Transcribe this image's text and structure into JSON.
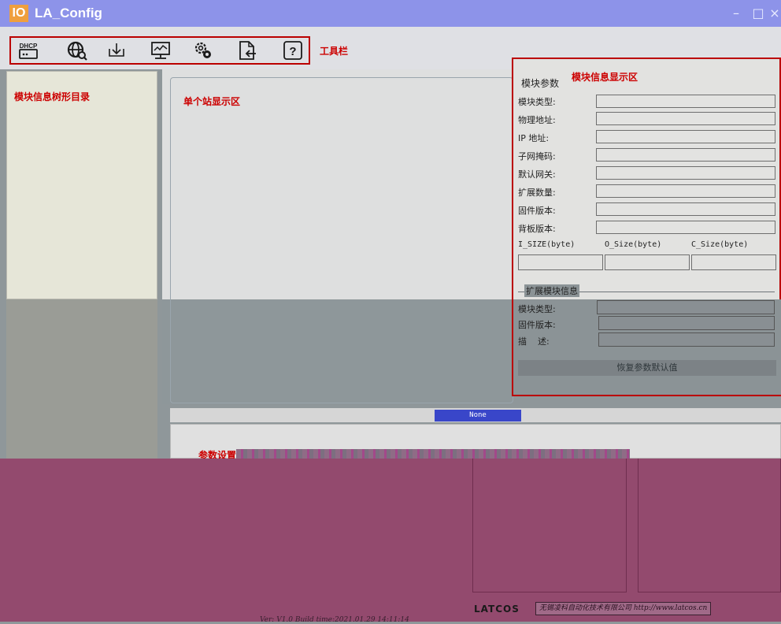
{
  "window": {
    "badge": "IO",
    "title": "LA_Config",
    "controls": {
      "minimize": "–",
      "maximize": "□",
      "close": "×"
    }
  },
  "toolbar": {
    "label": "工具栏",
    "buttons": [
      {
        "name": "dhcp",
        "icon": "dhcp-icon",
        "text": "DHCP"
      },
      {
        "name": "network-scan",
        "icon": "globe-search-icon"
      },
      {
        "name": "download",
        "icon": "download-icon"
      },
      {
        "name": "monitor",
        "icon": "monitor-chart-icon"
      },
      {
        "name": "settings",
        "icon": "gears-icon"
      },
      {
        "name": "export",
        "icon": "file-export-icon"
      },
      {
        "name": "help",
        "icon": "help-icon",
        "text": "?"
      }
    ]
  },
  "tree": {
    "label": "模块信息树形目录"
  },
  "station": {
    "label": "单个站显示区"
  },
  "info": {
    "title": "模块信息显示区",
    "group_title": "模块参数",
    "fields": [
      {
        "label": "模块类型:",
        "value": ""
      },
      {
        "label": "物理地址:",
        "value": ""
      },
      {
        "label": " IP 地址:",
        "value": ""
      },
      {
        "label": "子网掩码:",
        "value": ""
      },
      {
        "label": "默认网关:",
        "value": ""
      },
      {
        "label": "扩展数量:",
        "value": ""
      },
      {
        "label": "固件版本:",
        "value": ""
      },
      {
        "label": "背板版本:",
        "value": ""
      }
    ],
    "size_headers": [
      "I_SIZE(byte)",
      "O_Size(byte)",
      "C_Size(byte)"
    ],
    "size_values": [
      "",
      "",
      ""
    ],
    "ext": {
      "title": "扩展模块信息",
      "fields": [
        {
          "label": "模块类型:",
          "value": ""
        },
        {
          "label": "固件版本:",
          "value": ""
        },
        {
          "label": "描    述:",
          "value": ""
        }
      ]
    },
    "restore_button": "恢复参数默认值"
  },
  "status": {
    "badge": "None"
  },
  "params": {
    "label": "参数设置"
  },
  "footer": {
    "version": "Ver: V1.0 Build time:2021.01.29 14:11:14",
    "logo": "LATCOS",
    "company": "无锡凌科自动化技术有限公司 http://www.latcos.cn"
  },
  "colors": {
    "titlebar": "#8d93e9",
    "annotation_red": "#cc0000",
    "status_badge": "#3946c9",
    "magenta_overlay": "#934a6e"
  }
}
